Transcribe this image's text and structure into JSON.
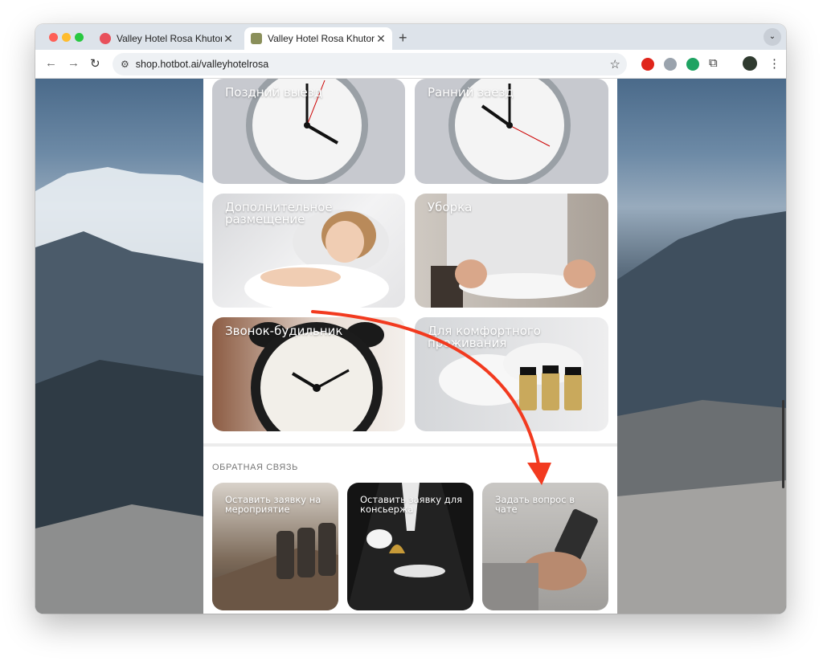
{
  "browser": {
    "tabs": [
      {
        "title": "Valley Hotel Rosa Khutor | Ho",
        "active": false
      },
      {
        "title": "Valley Hotel Rosa Khutor",
        "active": true
      }
    ],
    "new_tab": "+",
    "tab_close": "✕",
    "tab_menu": "⌄",
    "back": "←",
    "forward": "→",
    "reload": "↻",
    "site_icon": "⚙",
    "url": "shop.hotbot.ai/valleyhotelrosa",
    "bookmark": "☆",
    "extensions": [
      "opera-icon",
      "globe-icon",
      "quote-icon",
      "puzzle-icon"
    ],
    "puzzle": "⧉",
    "menu": "⋮"
  },
  "services": [
    {
      "title": "Поздний выезд",
      "image": "clock-icon"
    },
    {
      "title": "Ранний заезд",
      "image": "clock-icon"
    },
    {
      "title": "Дополнительное размещение",
      "image": "sleeping-woman"
    },
    {
      "title": "Уборка",
      "image": "folding-towel"
    },
    {
      "title": "Звонок-будильник",
      "image": "alarm-clock-icon"
    },
    {
      "title": "Для комфортного проживания",
      "image": "towels-and-toiletries"
    }
  ],
  "feedback": {
    "section_label": "ОБРАТНАЯ СВЯЗЬ",
    "cards": [
      {
        "title": "Оставить заявку на мероприятие",
        "image": "conference-room"
      },
      {
        "title": "Оставить заявку для консьержа",
        "image": "butler-with-bell"
      },
      {
        "title": "Задать вопрос в чате",
        "image": "hand-with-phone"
      }
    ]
  },
  "colors": {
    "annotation_arrow": "#f23a1f",
    "page_panel": "#ffffff",
    "tab_bar": "#dde3ea"
  }
}
